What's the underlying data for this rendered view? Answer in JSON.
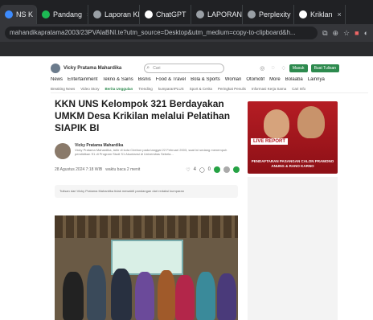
{
  "browser": {
    "tabs": [
      {
        "label": "NS K",
        "active": true,
        "icon_color": "#3d8bfd"
      },
      {
        "label": "Pandang",
        "active": false,
        "icon_color": "#1db954"
      },
      {
        "label": "Laporan KK",
        "active": false,
        "icon_color": "#9aa0a6"
      },
      {
        "label": "ChatGPT",
        "active": false,
        "icon_color": "#ffffff"
      },
      {
        "label": "LAPORAN M",
        "active": false,
        "icon_color": "#9aa0a6"
      },
      {
        "label": "Perplexity",
        "active": false,
        "icon_color": "#9aa0a6"
      },
      {
        "label": "Kriklan",
        "active": false,
        "icon_color": "#ffffff"
      }
    ],
    "url": "mahandikapratama2003/23PVAlaBNI.te?utm_source=Desktop&utm_medium=copy-to-clipboard&h..."
  },
  "site": {
    "author_label": "Vicky Pratama Mahardika",
    "search_placeholder": "Cari",
    "buttons": [
      "Masuk",
      "Buat Tulisan"
    ],
    "nav_main": [
      "News",
      "Entertainment",
      "Tekno & Sains",
      "Bisnis",
      "Food & Travel",
      "Bola & Sports",
      "Woman",
      "Otomotif",
      "More",
      "Bolaaba",
      "Lainnya"
    ],
    "nav_sub": [
      "Breaking News",
      "Video Story",
      "Berita Unggulan",
      "Trending",
      "kumparanPLUS",
      "Sport & Cerita",
      "Peringkat Penulis",
      "Informasi Kerja Sama",
      "Cari Info"
    ],
    "trend_index": 2
  },
  "article": {
    "title": "KKN UNS Kelompok 321 Berdayakan UMKM Desa Krikilan melalui Pelatihan SIAPIK BI",
    "author": "Vicky Pratama Mahardika",
    "author_bio": "Vicky Pratama Mahardika, lahir di kota Cirebon pada tanggal 22 Februari 2003, saat ini sedang menempuh pendidikan S1 di Program Studi S1 Akuntansi di Universitas Sebela...",
    "date": "28 Agustus 2024 7:18 WIB",
    "read_time": "waktu baca 2 menit",
    "likes": "4",
    "comments": "0",
    "disclaimer": "Tulisan dari Vicky Pratama Mahardika tidak mewakili pandangan dari redaksi kumparan"
  },
  "ad": {
    "live_label": "LIVE REPORT",
    "headline": "PENDAFTARAN PASANGAN CALON PRAMONO ANUNG & RANO KARNO"
  }
}
